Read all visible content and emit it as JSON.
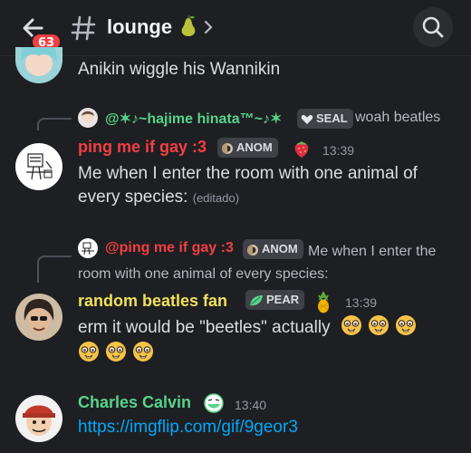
{
  "header": {
    "unread_count": "63",
    "channel_name": "lounge"
  },
  "messages": [
    {
      "text": "Anikin wiggle his Wannikin"
    },
    {
      "reply": {
        "author": "@✶♪~hajime hinata™~♪✶",
        "tag": "SEAL",
        "preview": "woah beatles"
      },
      "author": "ping me if gay :3",
      "author_color": "#f23f43",
      "tag": "ANOM",
      "time": "13:39",
      "lines": [
        "Me when I enter the room with one animal of",
        "every species:"
      ],
      "edited": "(editado)"
    },
    {
      "reply": {
        "author": "@ping me if gay :3",
        "tag": "ANOM",
        "preview_line1": "Me when I enter the",
        "preview_line2": "room with one animal of every species:"
      },
      "author": "random beatles fan",
      "author_color": "#f0e15a",
      "tag": "PEAR",
      "time": "13:39",
      "text": "erm it would be \"beetles\" actually"
    },
    {
      "author": "Charles Calvin",
      "author_color": "#57d38a",
      "time": "13:40",
      "link": "https://imgflip.com/gif/9geor3"
    }
  ]
}
